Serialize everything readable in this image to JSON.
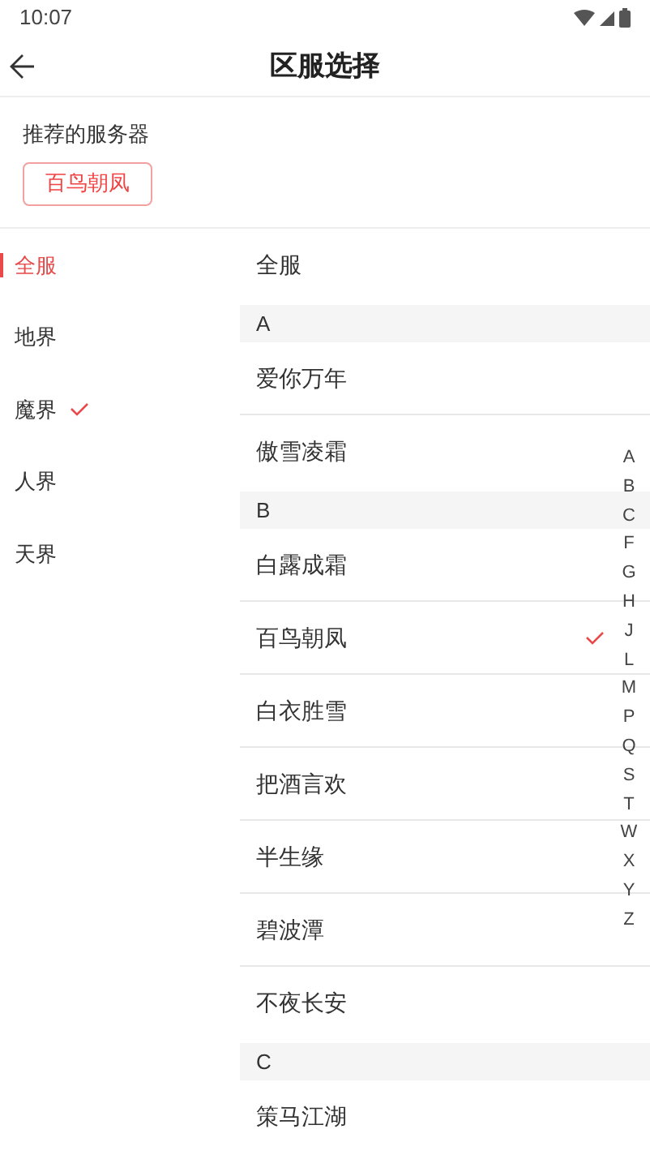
{
  "status_bar": {
    "time": "10:07"
  },
  "header": {
    "title": "区服选择"
  },
  "recommended": {
    "label": "推荐的服务器",
    "servers": [
      "百鸟朝凤"
    ]
  },
  "categories": [
    {
      "label": "全服",
      "selected": true,
      "current": false
    },
    {
      "label": "地界",
      "selected": false,
      "current": false
    },
    {
      "label": "魔界",
      "selected": false,
      "current": true
    },
    {
      "label": "人界",
      "selected": false,
      "current": false
    },
    {
      "label": "天界",
      "selected": false,
      "current": false
    }
  ],
  "servers": [
    {
      "kind": "item",
      "label": "全服",
      "checked": false
    },
    {
      "kind": "header",
      "label": "A"
    },
    {
      "kind": "item",
      "label": "爱你万年",
      "checked": false
    },
    {
      "kind": "item",
      "label": "傲雪凌霜",
      "checked": false
    },
    {
      "kind": "header",
      "label": "B"
    },
    {
      "kind": "item",
      "label": "白露成霜",
      "checked": false
    },
    {
      "kind": "item",
      "label": "百鸟朝凤",
      "checked": true
    },
    {
      "kind": "item",
      "label": "白衣胜雪",
      "checked": false
    },
    {
      "kind": "item",
      "label": "把酒言欢",
      "checked": false
    },
    {
      "kind": "item",
      "label": "半生缘",
      "checked": false
    },
    {
      "kind": "item",
      "label": "碧波潭",
      "checked": false
    },
    {
      "kind": "item",
      "label": "不夜长安",
      "checked": false
    },
    {
      "kind": "header",
      "label": "C"
    },
    {
      "kind": "item",
      "label": "策马江湖",
      "checked": false
    }
  ],
  "index": [
    "A",
    "B",
    "C",
    "F",
    "G",
    "H",
    "J",
    "L",
    "M",
    "P",
    "Q",
    "S",
    "T",
    "W",
    "X",
    "Y",
    "Z"
  ]
}
